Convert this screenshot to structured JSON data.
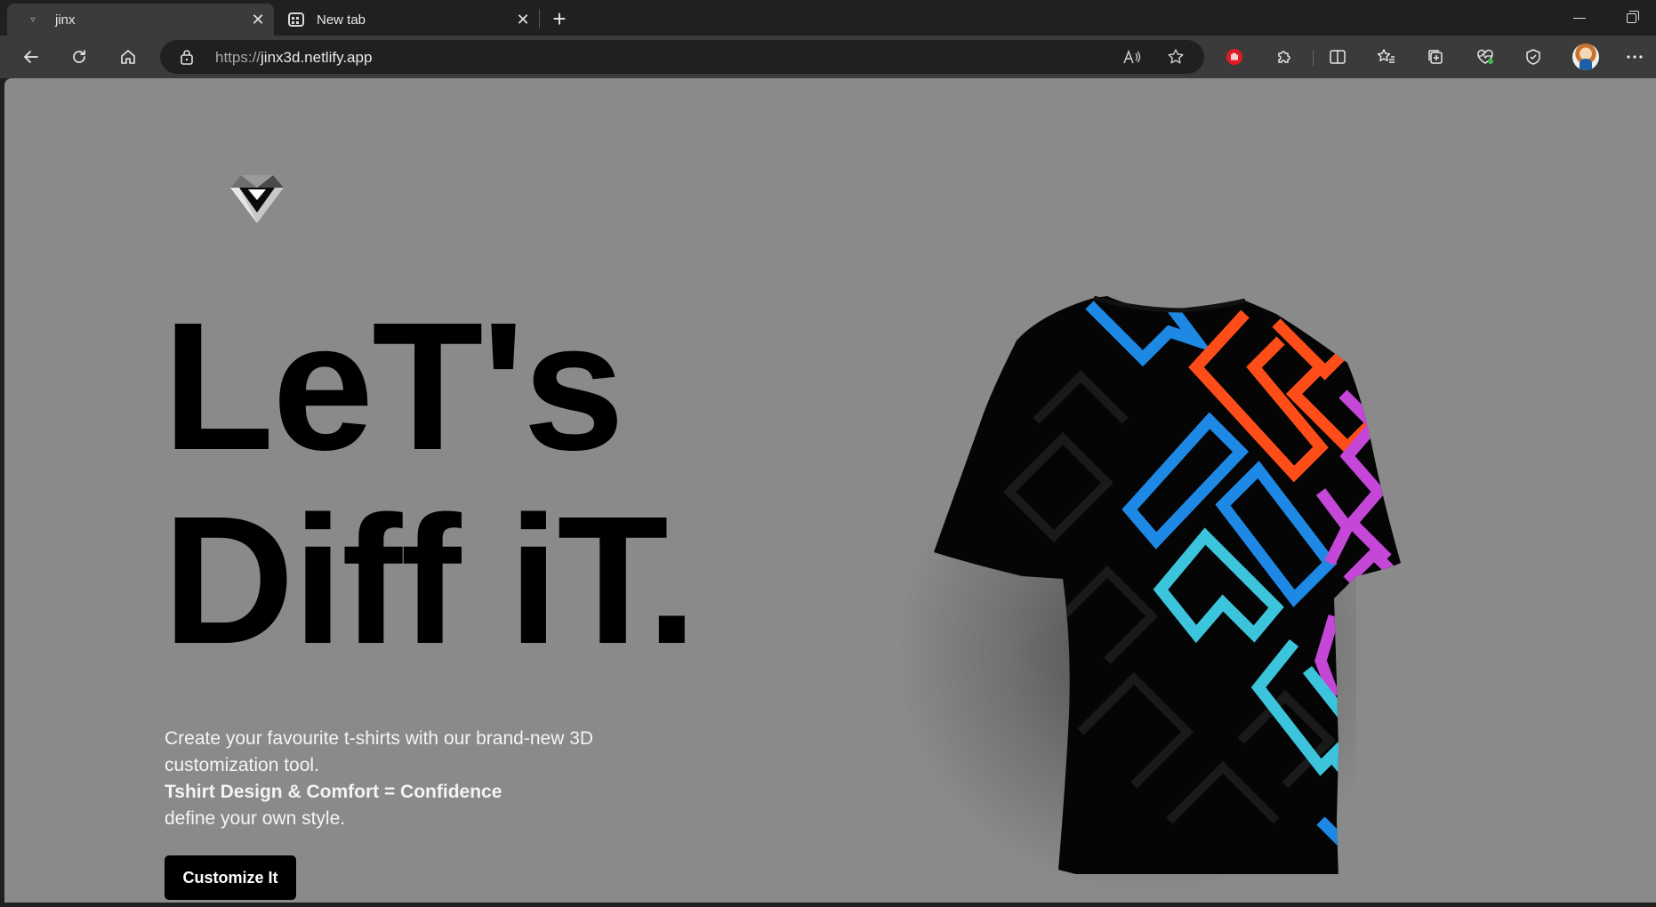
{
  "browser": {
    "tabs": [
      {
        "title": "jinx",
        "favicon": "jinx-favicon",
        "active": true
      },
      {
        "title": "New tab",
        "favicon": "newtab-icon",
        "active": false
      }
    ],
    "close_glyph": "✕",
    "new_tab_glyph": "+",
    "address": {
      "scheme": "https://",
      "host": "jinx3d.netlify.app"
    }
  },
  "page": {
    "headline": {
      "line1": "LeT's",
      "line2": "Diff iT."
    },
    "description": {
      "line1": "Create your favourite t-shirts with our brand-new 3D customization tool.",
      "bold": "Tshirt Design & Comfort = Confidence",
      "line3": "define your own style."
    },
    "cta_label": "Customize It"
  },
  "colors": {
    "page_background": "#8a8a8a",
    "text_dark": "#000000",
    "button_background": "#000000",
    "shirt_blue": "#1e88e5",
    "shirt_orange": "#ff4d1a",
    "shirt_magenta": "#c447d8",
    "shirt_pink": "#ff2a6a",
    "shirt_cyan": "#3cc4dc"
  }
}
